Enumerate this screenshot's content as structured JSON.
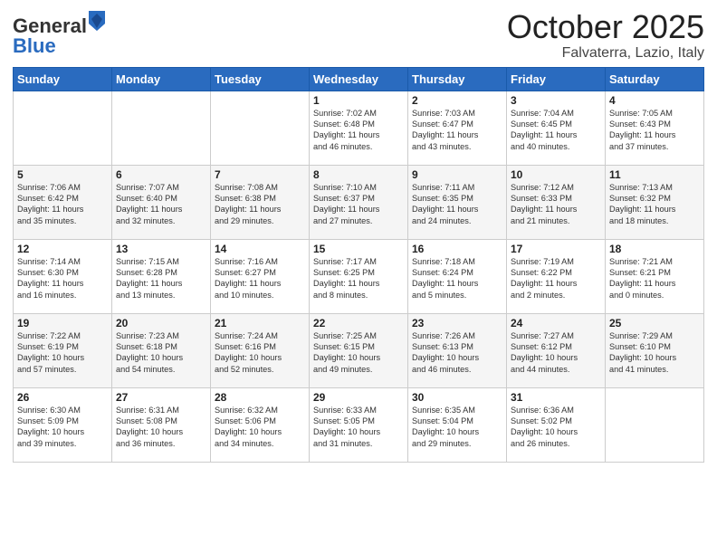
{
  "logo": {
    "general": "General",
    "blue": "Blue"
  },
  "header": {
    "month": "October 2025",
    "location": "Falvaterra, Lazio, Italy"
  },
  "days_of_week": [
    "Sunday",
    "Monday",
    "Tuesday",
    "Wednesday",
    "Thursday",
    "Friday",
    "Saturday"
  ],
  "weeks": [
    [
      {
        "day": "",
        "info": ""
      },
      {
        "day": "",
        "info": ""
      },
      {
        "day": "",
        "info": ""
      },
      {
        "day": "1",
        "info": "Sunrise: 7:02 AM\nSunset: 6:48 PM\nDaylight: 11 hours\nand 46 minutes."
      },
      {
        "day": "2",
        "info": "Sunrise: 7:03 AM\nSunset: 6:47 PM\nDaylight: 11 hours\nand 43 minutes."
      },
      {
        "day": "3",
        "info": "Sunrise: 7:04 AM\nSunset: 6:45 PM\nDaylight: 11 hours\nand 40 minutes."
      },
      {
        "day": "4",
        "info": "Sunrise: 7:05 AM\nSunset: 6:43 PM\nDaylight: 11 hours\nand 37 minutes."
      }
    ],
    [
      {
        "day": "5",
        "info": "Sunrise: 7:06 AM\nSunset: 6:42 PM\nDaylight: 11 hours\nand 35 minutes."
      },
      {
        "day": "6",
        "info": "Sunrise: 7:07 AM\nSunset: 6:40 PM\nDaylight: 11 hours\nand 32 minutes."
      },
      {
        "day": "7",
        "info": "Sunrise: 7:08 AM\nSunset: 6:38 PM\nDaylight: 11 hours\nand 29 minutes."
      },
      {
        "day": "8",
        "info": "Sunrise: 7:10 AM\nSunset: 6:37 PM\nDaylight: 11 hours\nand 27 minutes."
      },
      {
        "day": "9",
        "info": "Sunrise: 7:11 AM\nSunset: 6:35 PM\nDaylight: 11 hours\nand 24 minutes."
      },
      {
        "day": "10",
        "info": "Sunrise: 7:12 AM\nSunset: 6:33 PM\nDaylight: 11 hours\nand 21 minutes."
      },
      {
        "day": "11",
        "info": "Sunrise: 7:13 AM\nSunset: 6:32 PM\nDaylight: 11 hours\nand 18 minutes."
      }
    ],
    [
      {
        "day": "12",
        "info": "Sunrise: 7:14 AM\nSunset: 6:30 PM\nDaylight: 11 hours\nand 16 minutes."
      },
      {
        "day": "13",
        "info": "Sunrise: 7:15 AM\nSunset: 6:28 PM\nDaylight: 11 hours\nand 13 minutes."
      },
      {
        "day": "14",
        "info": "Sunrise: 7:16 AM\nSunset: 6:27 PM\nDaylight: 11 hours\nand 10 minutes."
      },
      {
        "day": "15",
        "info": "Sunrise: 7:17 AM\nSunset: 6:25 PM\nDaylight: 11 hours\nand 8 minutes."
      },
      {
        "day": "16",
        "info": "Sunrise: 7:18 AM\nSunset: 6:24 PM\nDaylight: 11 hours\nand 5 minutes."
      },
      {
        "day": "17",
        "info": "Sunrise: 7:19 AM\nSunset: 6:22 PM\nDaylight: 11 hours\nand 2 minutes."
      },
      {
        "day": "18",
        "info": "Sunrise: 7:21 AM\nSunset: 6:21 PM\nDaylight: 11 hours\nand 0 minutes."
      }
    ],
    [
      {
        "day": "19",
        "info": "Sunrise: 7:22 AM\nSunset: 6:19 PM\nDaylight: 10 hours\nand 57 minutes."
      },
      {
        "day": "20",
        "info": "Sunrise: 7:23 AM\nSunset: 6:18 PM\nDaylight: 10 hours\nand 54 minutes."
      },
      {
        "day": "21",
        "info": "Sunrise: 7:24 AM\nSunset: 6:16 PM\nDaylight: 10 hours\nand 52 minutes."
      },
      {
        "day": "22",
        "info": "Sunrise: 7:25 AM\nSunset: 6:15 PM\nDaylight: 10 hours\nand 49 minutes."
      },
      {
        "day": "23",
        "info": "Sunrise: 7:26 AM\nSunset: 6:13 PM\nDaylight: 10 hours\nand 46 minutes."
      },
      {
        "day": "24",
        "info": "Sunrise: 7:27 AM\nSunset: 6:12 PM\nDaylight: 10 hours\nand 44 minutes."
      },
      {
        "day": "25",
        "info": "Sunrise: 7:29 AM\nSunset: 6:10 PM\nDaylight: 10 hours\nand 41 minutes."
      }
    ],
    [
      {
        "day": "26",
        "info": "Sunrise: 6:30 AM\nSunset: 5:09 PM\nDaylight: 10 hours\nand 39 minutes."
      },
      {
        "day": "27",
        "info": "Sunrise: 6:31 AM\nSunset: 5:08 PM\nDaylight: 10 hours\nand 36 minutes."
      },
      {
        "day": "28",
        "info": "Sunrise: 6:32 AM\nSunset: 5:06 PM\nDaylight: 10 hours\nand 34 minutes."
      },
      {
        "day": "29",
        "info": "Sunrise: 6:33 AM\nSunset: 5:05 PM\nDaylight: 10 hours\nand 31 minutes."
      },
      {
        "day": "30",
        "info": "Sunrise: 6:35 AM\nSunset: 5:04 PM\nDaylight: 10 hours\nand 29 minutes."
      },
      {
        "day": "31",
        "info": "Sunrise: 6:36 AM\nSunset: 5:02 PM\nDaylight: 10 hours\nand 26 minutes."
      },
      {
        "day": "",
        "info": ""
      }
    ]
  ]
}
